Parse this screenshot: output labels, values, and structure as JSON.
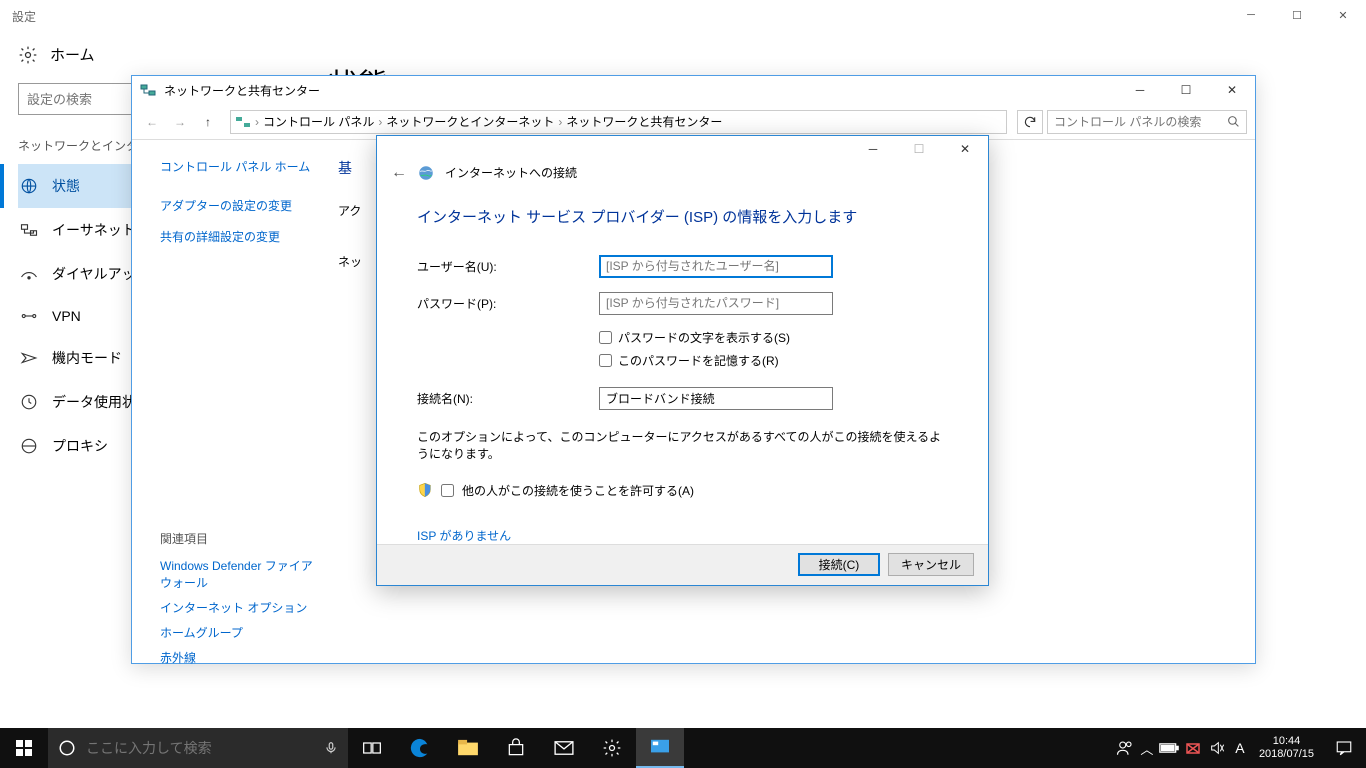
{
  "settings": {
    "title": "設定",
    "home": "ホーム",
    "search_placeholder": "設定の検索",
    "category": "ネットワークとインター",
    "nav": {
      "status": "状態",
      "ethernet": "イーサネット",
      "dialup": "ダイヤルアップ",
      "vpn": "VPN",
      "airplane": "機内モード",
      "data": "データ使用状",
      "proxy": "プロキシ"
    },
    "main_h1": "状態"
  },
  "network": {
    "title": "ネットワークと共有センター",
    "breadcrumb": {
      "b1": "コントロール パネル",
      "b2": "ネットワークとインターネット",
      "b3": "ネットワークと共有センター"
    },
    "search_placeholder": "コントロール パネルの検索",
    "side": {
      "cp_home": "コントロール パネル ホーム",
      "adapter": "アダプターの設定の変更",
      "sharing": "共有の詳細設定の変更",
      "related_h": "関連項目",
      "defender": "Windows Defender ファイアウォール",
      "inetopt": "インターネット オプション",
      "homegroup": "ホームグループ",
      "infrared": "赤外線"
    },
    "main": {
      "h": "基",
      "sub1": "アク",
      "sub2": "ネッ"
    }
  },
  "dialog": {
    "header_title": "インターネットへの接続",
    "h1": "インターネット サービス プロバイダー (ISP) の情報を入力します",
    "username_label": "ユーザー名(U):",
    "username_placeholder": "[ISP から付与されたユーザー名]",
    "password_label": "パスワード(P):",
    "password_placeholder": "[ISP から付与されたパスワード]",
    "show_pw": "パスワードの文字を表示する(S)",
    "remember_pw": "このパスワードを記憶する(R)",
    "conn_label": "接続名(N):",
    "conn_value": "ブロードバンド接続",
    "note": "このオプションによって、このコンピューターにアクセスがあるすべての人がこの接続を使えるようになります。",
    "allow": "他の人がこの接続を使うことを許可する(A)",
    "no_isp": "ISP がありません",
    "btn_connect": "接続(C)",
    "btn_cancel": "キャンセル"
  },
  "taskbar": {
    "search_placeholder": "ここに入力して検索",
    "time": "10:44",
    "date": "2018/07/15"
  }
}
